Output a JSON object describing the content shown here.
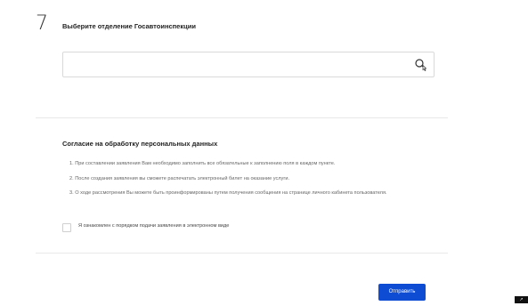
{
  "step": {
    "number": "7",
    "title": "Выберите отделение Госавтоинспекции"
  },
  "search": {
    "value": "",
    "placeholder": "",
    "icon": "search-icon"
  },
  "consent": {
    "title": "Согласие на обработку персональных данных",
    "items": [
      "1. При составлении заявления Вам необходимо заполнить все обязательные к заполнению поля в каждом пункте.",
      "2. После создания заявления вы сможете распечатать электронный билет на оказание услуги.",
      "3. О ходе рассмотрения Вы можете быть проинформированы путем получения сообщения на странице личного кабинета пользователя."
    ],
    "checkbox_label": "Я ознакомлен с порядком подачи заявления в электронном виде",
    "checked": false
  },
  "actions": {
    "submit_label": "Отправить"
  },
  "colors": {
    "accent": "#0d4cd3",
    "divider": "#e8e8e8"
  },
  "corner_badge": {
    "icon": "bookmarklet-icon"
  }
}
